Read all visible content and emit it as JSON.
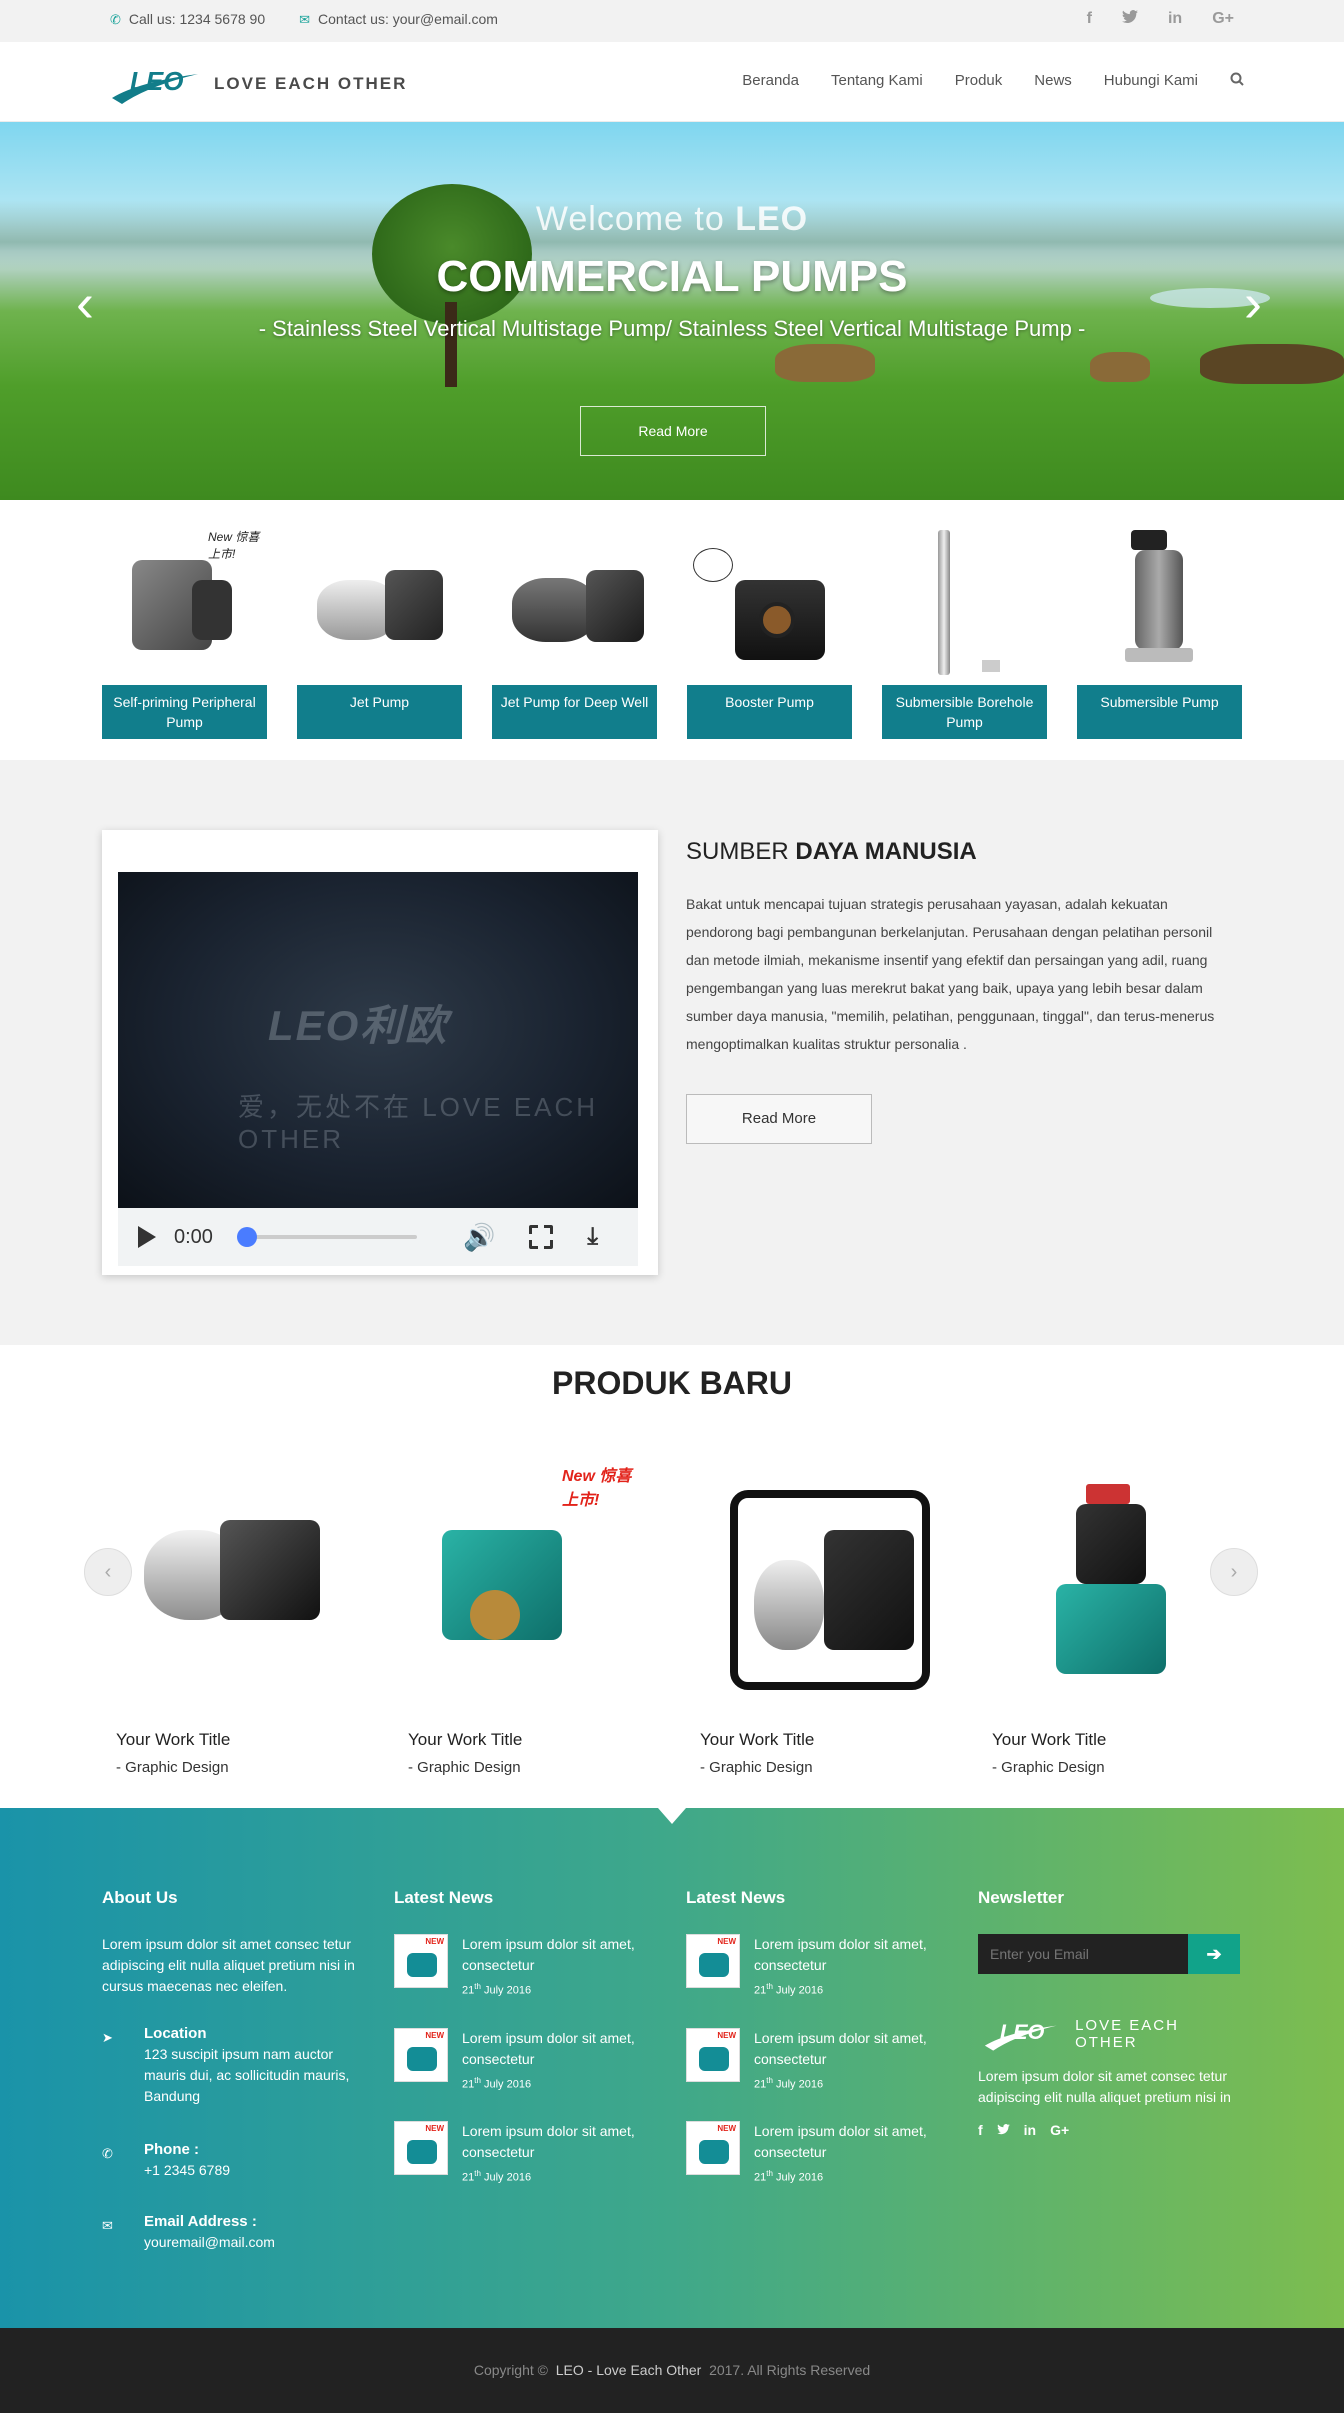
{
  "topbar": {
    "phone": "Call us: 1234 5678 90",
    "email": "Contact us: your@email.com",
    "social": [
      "f",
      "t",
      "in",
      "G+"
    ]
  },
  "nav": {
    "logo_text": "LEO",
    "tagline": "LOVE EACH OTHER",
    "menu": [
      "Beranda",
      "Tentang Kami",
      "Produk",
      "News",
      "Hubungi Kami"
    ]
  },
  "hero": {
    "welcome_prefix": "Welcome to",
    "welcome_brand": "LEO",
    "headline": "COMMERCIAL PUMPS",
    "subline": "- Stainless Steel Vertical Multistage Pump/ Stainless Steel Vertical Multistage Pump -",
    "button": "Read More",
    "prev": "‹",
    "next": "›"
  },
  "categories": [
    {
      "label": "Self-priming Peripheral Pump",
      "badge": "New 惊喜上市!"
    },
    {
      "label": "Jet Pump"
    },
    {
      "label": "Jet Pump for Deep Well"
    },
    {
      "label": "Booster Pump"
    },
    {
      "label": "Submersible Borehole Pump"
    },
    {
      "label": "Submersible Pump"
    }
  ],
  "hr_section": {
    "title_light": "SUMBER",
    "title_bold": "DAYA MANUSIA",
    "body": "Bakat untuk mencapai tujuan strategis perusahaan yayasan, adalah kekuatan pendorong bagi pembangunan berkelanjutan. Perusahaan dengan pelatihan personil dan metode ilmiah, mekanisme insentif yang efektif dan persaingan yang adil, ruang pengembangan yang luas merekrut bakat yang baik, upaya yang lebih besar dalam sumber daya manusia, \"memilih, pelatihan, penggunaan, tinggal\", dan terus-menerus mengoptimalkan kualitas struktur personalia .",
    "button": "Read More",
    "video": {
      "logo": "LEO利欧",
      "tag": "爱，无处不在 LOVE EACH OTHER",
      "time": "0:00",
      "progress": 0
    }
  },
  "new_products": {
    "title": "PRODUK BARU",
    "items": [
      {
        "title": "Your Work Title",
        "category": "- Graphic Design"
      },
      {
        "title": "Your Work Title",
        "category": "- Graphic Design",
        "badge": "New 惊喜上市!"
      },
      {
        "title": "Your Work Title",
        "category": "- Graphic Design"
      },
      {
        "title": "Your Work Title",
        "category": "- Graphic Design"
      }
    ]
  },
  "footer": {
    "about": {
      "title": "About Us",
      "text": "Lorem ipsum dolor sit amet consec tetur adipiscing elit nulla aliquet pretium nisi in cursus maecenas nec eleifen.",
      "location_label": "Location",
      "location": "123 suscipit ipsum nam auctor mauris dui, ac sollicitudin mauris, Bandung",
      "phone_label": "Phone :",
      "phone": "+1 2345 6789",
      "email_label": "Email Address :",
      "email": "youremail@mail.com"
    },
    "news_title": "Latest News",
    "news": [
      {
        "text": "Lorem ipsum dolor sit amet, consectetur",
        "day": "21",
        "sup": "th",
        "rest": " July 2016"
      },
      {
        "text": "Lorem ipsum dolor sit amet, consectetur",
        "day": "21",
        "sup": "th",
        "rest": " July 2016"
      },
      {
        "text": "Lorem ipsum dolor sit amet, consectetur",
        "day": "21",
        "sup": "th",
        "rest": " July 2016"
      }
    ],
    "newsletter": {
      "title": "Newsletter",
      "placeholder": "Enter you Email",
      "logo": "LEO",
      "tagline": "LOVE EACH OTHER",
      "text": "Lorem ipsum dolor sit amet consec tetur adipiscing elit nulla aliquet pretium nisi in",
      "social": [
        "f",
        "t",
        "in",
        "G+"
      ]
    },
    "copyright_prefix": "Copyright ©",
    "copyright_brand": "LEO - Love Each Other",
    "copyright_suffix": "2017. All Rights Reserved"
  },
  "colors": {
    "accent": "#117e8c",
    "footer_start": "#1a93a9",
    "footer_end": "#7dbd4f"
  }
}
